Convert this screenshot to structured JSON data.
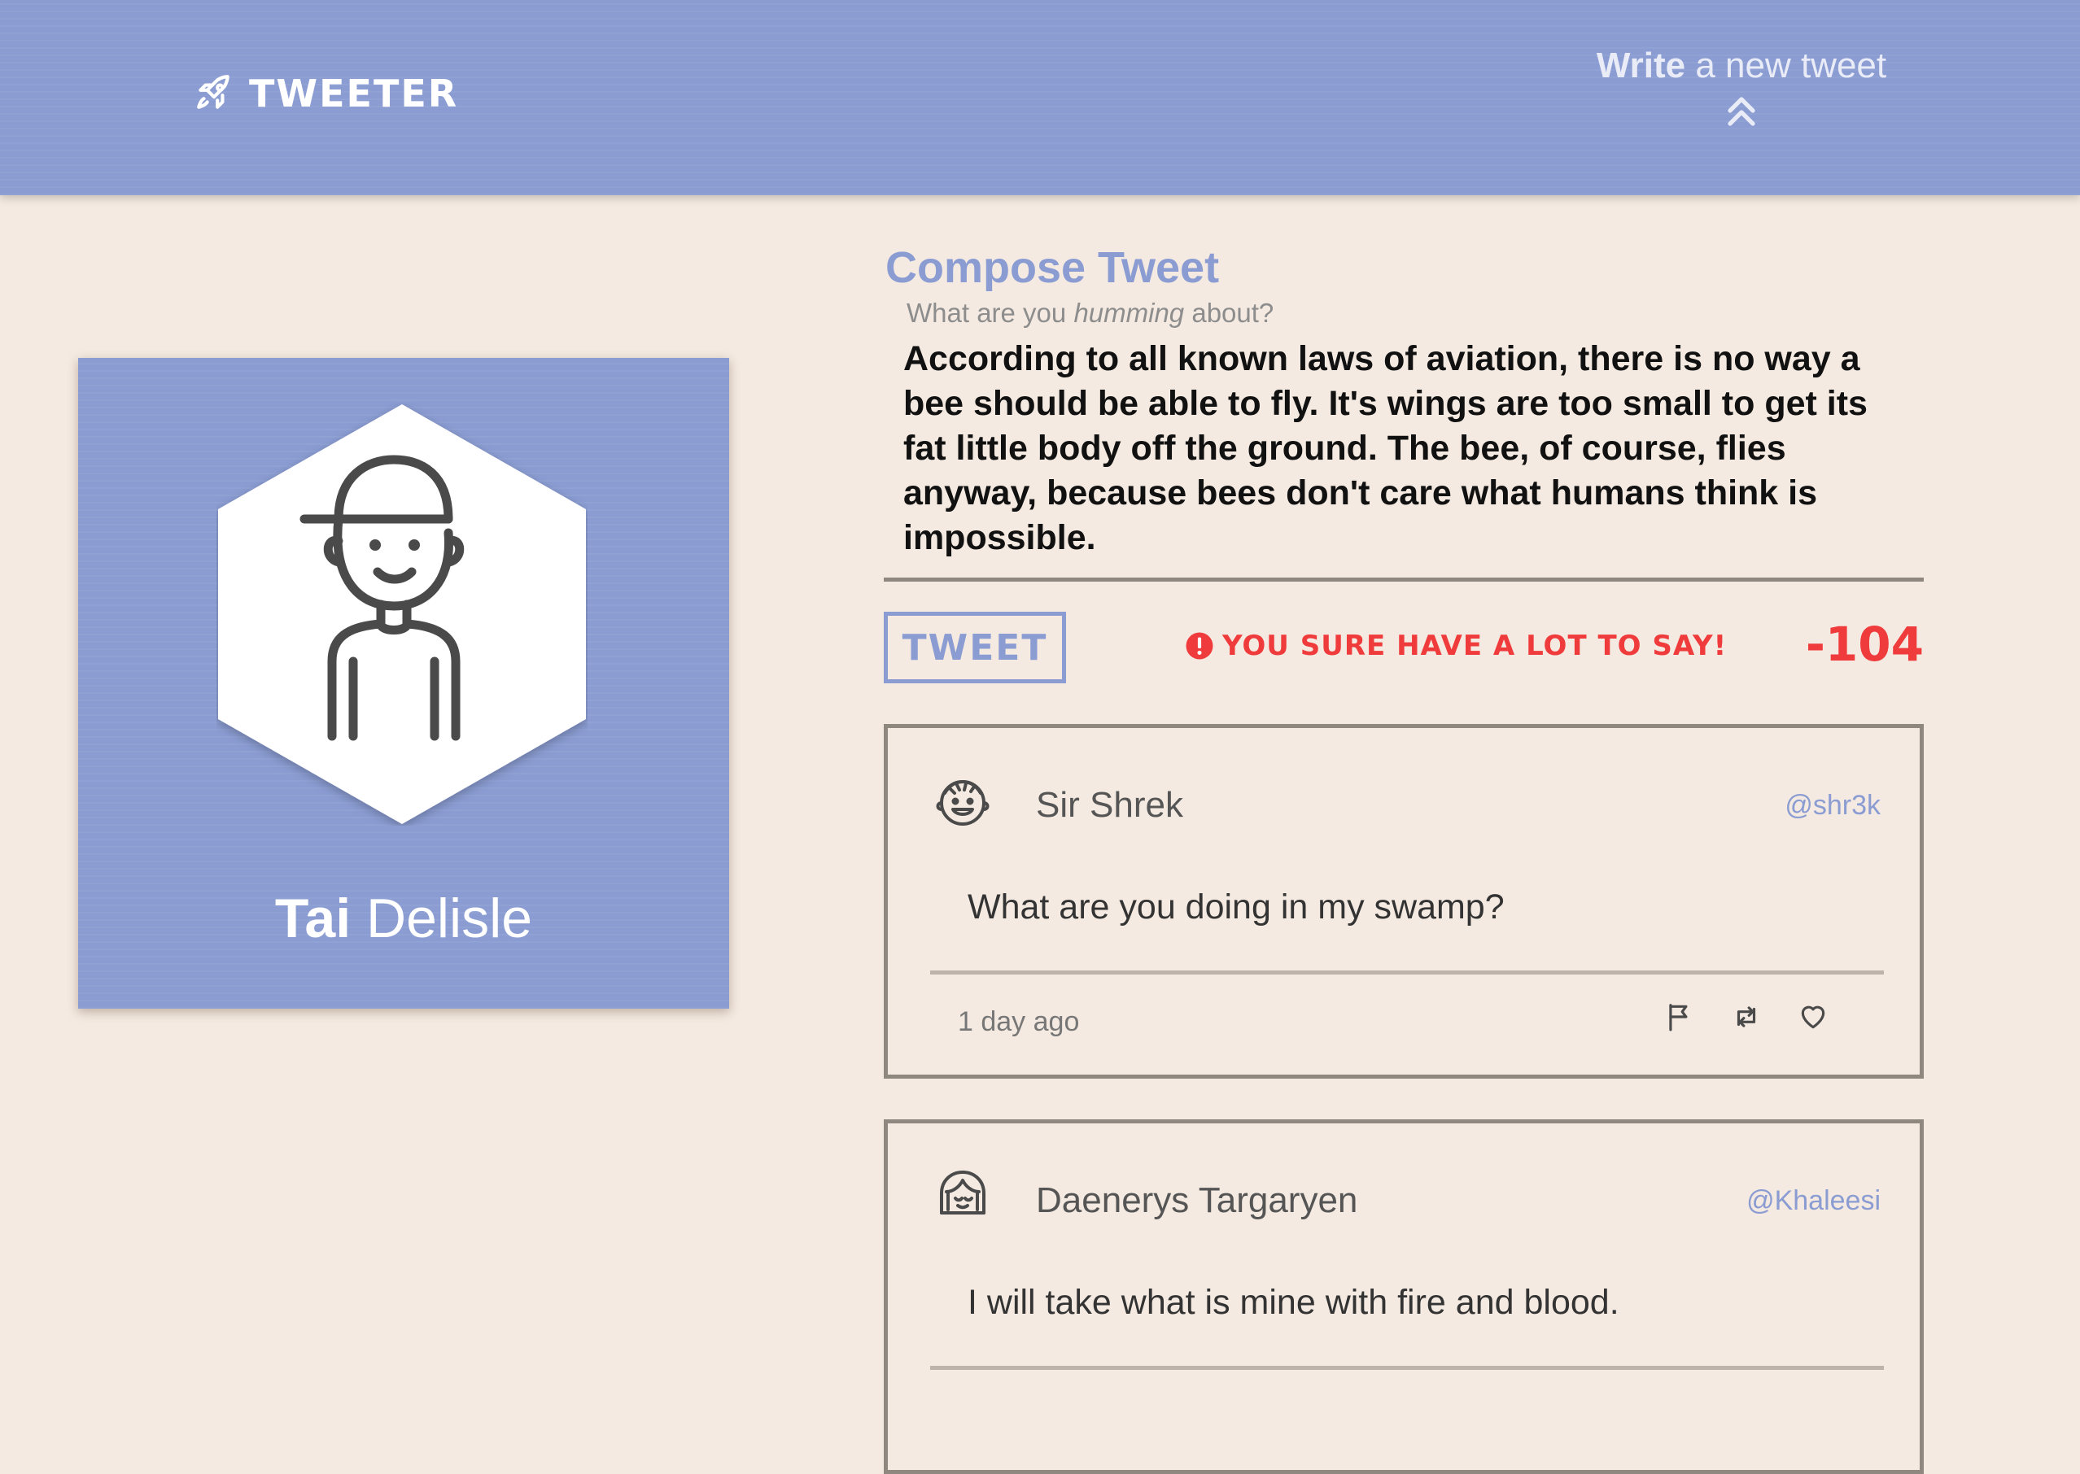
{
  "header": {
    "brand": "TWEETER",
    "compose_toggle_bold": "Write",
    "compose_toggle_rest": " a new tweet"
  },
  "profile": {
    "first_name": "Tai",
    "last_name": " Delisle"
  },
  "compose": {
    "title": "Compose Tweet",
    "subtitle_pre": "What are you ",
    "subtitle_em": "humming",
    "subtitle_post": " about?",
    "text": "According to all known laws of aviation, there is no way a bee should be able to fly. It's wings are too small to get its fat little body off the ground. The bee, of course, flies anyway, because bees don't care what humans think is impossible.",
    "button_label": "TWEET",
    "error_message": "YOU SURE HAVE A LOT TO SAY!",
    "counter": "-104"
  },
  "tweets": [
    {
      "name": "Sir Shrek",
      "handle": "@shr3k",
      "text": "What are you doing in my swamp?",
      "time": "1 day ago"
    },
    {
      "name": "Daenerys Targaryen",
      "handle": "@Khaleesi",
      "text": "I will take what is mine with fire and blood."
    }
  ],
  "colors": {
    "accent": "#8a9cd2",
    "background": "#f4eae1",
    "error": "#ef3b3b",
    "border": "#8e8880"
  },
  "icons": {
    "brand": "rocket-icon",
    "toggle": "double-chevron-up-icon",
    "error": "exclamation-circle-icon",
    "actions": [
      "flag-icon",
      "retweet-icon",
      "heart-icon"
    ]
  }
}
